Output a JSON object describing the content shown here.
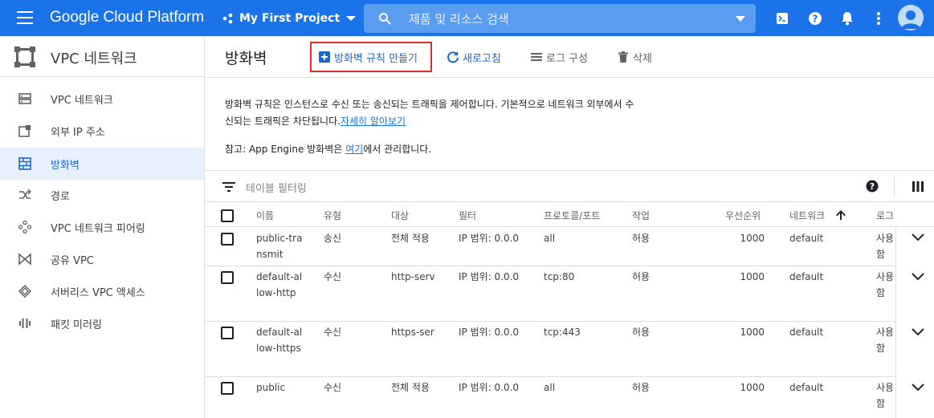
{
  "topbar": {
    "brand": "Google Cloud Platform",
    "project": "My First Project",
    "search_placeholder": "제품 및 리소스 검색"
  },
  "sidebar": {
    "title": "VPC 네트워크",
    "items": [
      {
        "label": "VPC 네트워크",
        "icon": "vpc-network-icon"
      },
      {
        "label": "외부 IP 주소",
        "icon": "external-ip-icon"
      },
      {
        "label": "방화벽",
        "icon": "firewall-icon"
      },
      {
        "label": "경로",
        "icon": "routes-icon"
      },
      {
        "label": "VPC 네트워크 피어링",
        "icon": "peering-icon"
      },
      {
        "label": "공유 VPC",
        "icon": "shared-vpc-icon"
      },
      {
        "label": "서버리스 VPC 액세스",
        "icon": "serverless-icon"
      },
      {
        "label": "패킷 미러링",
        "icon": "packet-mirroring-icon"
      }
    ],
    "active_index": 2
  },
  "main": {
    "title": "방화벽",
    "actions": {
      "create": "방화벽 규칙 만들기",
      "refresh": "새로고침",
      "logs": "로그 구성",
      "delete": "삭제"
    },
    "description": "방화벽 규칙은 인스턴스로 수신 또는 송신되는 트래픽을 제어합니다. 기본적으로 네트워크 외부에서 수신되는 트래픽은 차단됩니다.",
    "learn_more": "자세히 알아보기",
    "note_prefix": "참고: App Engine 방화벽은 ",
    "note_link": "여기",
    "note_suffix": "에서 관리합니다."
  },
  "table": {
    "filter_placeholder": "테이블 필터링",
    "headers": {
      "name": "이름",
      "type": "유형",
      "target": "대상",
      "filter": "필터",
      "protocol": "프로토콜/포트",
      "action": "작업",
      "priority": "우선순위",
      "network": "네트워크",
      "logs": "로그"
    },
    "rows": [
      {
        "name": "public-transmit",
        "type": "송신",
        "target": "전체 적용",
        "filter": "IP 범위: 0.0.0",
        "protocol": "all",
        "action": "허용",
        "priority": "1000",
        "network": "default",
        "logs": "사용 함"
      },
      {
        "name": "default-allow-http",
        "type": "수신",
        "target": "http-serv",
        "filter": "IP 범위: 0.0.0",
        "protocol": "tcp:80",
        "action": "허용",
        "priority": "1000",
        "network": "default",
        "logs": "사용 함"
      },
      {
        "name": "default-allow-https",
        "type": "수신",
        "target": "https-ser",
        "filter": "IP 범위: 0.0.0",
        "protocol": "tcp:443",
        "action": "허용",
        "priority": "1000",
        "network": "default",
        "logs": "사용 함"
      },
      {
        "name": "public",
        "type": "수신",
        "target": "전체 적용",
        "filter": "IP 범위: 0.0.0",
        "protocol": "all",
        "action": "허용",
        "priority": "1000",
        "network": "default",
        "logs": "사용 함"
      }
    ]
  },
  "colors": {
    "brand_blue": "#1a73e8",
    "highlight_red": "#d93025",
    "active_bg": "#e8f0fe"
  }
}
